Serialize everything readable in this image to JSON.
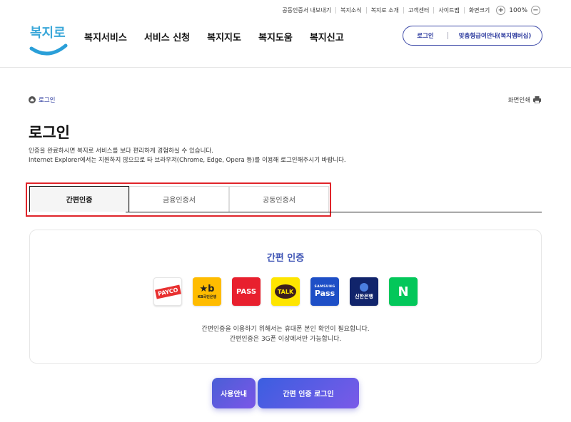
{
  "utility": {
    "links": [
      "공동인증서 내보내기",
      "복지소식",
      "복지로 소개",
      "고객센터",
      "사이트맵",
      "화면크기"
    ],
    "zoom_in": "+",
    "zoom_value": "100%",
    "zoom_out": "−"
  },
  "header": {
    "logo_text": "복지로",
    "nav": [
      "복지서비스",
      "서비스 신청",
      "복지지도",
      "복지도움",
      "복지신고"
    ],
    "login_label": "로그인",
    "info_label": "맞춤형급여안내(복지멤버십)"
  },
  "breadcrumb": {
    "label": "로그인"
  },
  "print_label": "화면인쇄",
  "page": {
    "title": "로그인",
    "desc_line1": "인증을 완료하시면 복지로 서비스를 보다 편리하게 경험하실 수 있습니다.",
    "desc_line2": "Internet Explorer에서는 지원하지 않으므로 타 브라우저(Chrome, Edge, Opera 등)를 이용해 로그인해주시기 바랍니다."
  },
  "tabs": [
    {
      "label": "간편인증",
      "active": true
    },
    {
      "label": "금융인증서",
      "active": false
    },
    {
      "label": "공동인증서",
      "active": false
    }
  ],
  "panel": {
    "title": "간편 인증",
    "providers": {
      "payco": "PAYCO",
      "kb_mark": "★b",
      "kb_text": "KB국민은행",
      "pass": "PASS",
      "kakao": "TALK",
      "samsung_top": "SAMSUNG",
      "samsung_pass": "Pass",
      "shinhan": "신한은행",
      "naver": "N"
    },
    "note_line1": "간편인증을 이용하기 위해서는 휴대폰 본인 확인이 필요합니다.",
    "note_line2": "간편인증은 3G폰 이상에서만 가능합니다."
  },
  "buttons": {
    "guide": "사용안내",
    "login": "간편 인증 로그인"
  },
  "colors": {
    "primary": "#3f55b5",
    "highlight_border": "#e0242a"
  }
}
